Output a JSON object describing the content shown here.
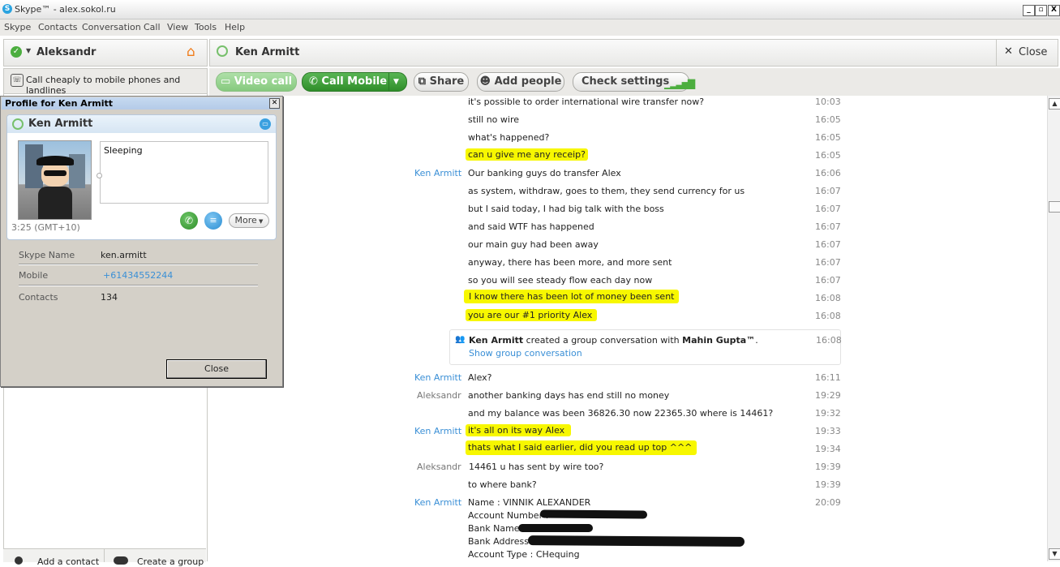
{
  "window": {
    "title": "Skype™ - alex.sokol.ru",
    "logo_letter": "S",
    "min": "_",
    "restore": "▫",
    "close": "X"
  },
  "menu": [
    "Skype",
    "Contacts",
    "Conversation",
    "Call",
    "View",
    "Tools",
    "Help"
  ],
  "left": {
    "user_name": "Aleksandr",
    "ad_text": "Call cheaply to mobile phones and landlines",
    "bottom_add": "Add a contact",
    "bottom_create": "Create a group"
  },
  "conversation": {
    "contact_name": "Ken Armitt",
    "close_label": "Close",
    "buttons": {
      "video_call": "Video call",
      "call_mobile": "Call Mobile",
      "share": "Share",
      "add_people": "Add people",
      "check_settings": "Check settings"
    }
  },
  "messages": [
    {
      "author": "",
      "text": "it's possible to order international wire transfer now?",
      "time": "10:03",
      "highlight": false
    },
    {
      "author": "",
      "text": "still no wire",
      "time": "16:05",
      "highlight": false
    },
    {
      "author": "",
      "text": "what's happened?",
      "time": "16:05",
      "highlight": false
    },
    {
      "author": "",
      "text": "can u give me any receip?",
      "time": "16:05",
      "highlight": true
    },
    {
      "author": "Ken Armitt",
      "text": "Our banking guys do transfer Alex",
      "time": "16:06",
      "highlight": false
    },
    {
      "author": "",
      "text": "as system, withdraw, goes to them, they send currency for us",
      "time": "16:07",
      "highlight": false
    },
    {
      "author": "",
      "text": "but I said today, I had big talk with the boss",
      "time": "16:07",
      "highlight": false
    },
    {
      "author": "",
      "text": "and said WTF has happened",
      "time": "16:07",
      "highlight": false
    },
    {
      "author": "",
      "text": "our main guy had been away",
      "time": "16:07",
      "highlight": false
    },
    {
      "author": "",
      "text": "anyway, there has been more, and more sent",
      "time": "16:07",
      "highlight": false
    },
    {
      "author": "",
      "text": "so you will see steady flow each day now",
      "time": "16:07",
      "highlight": false
    },
    {
      "author": "",
      "text": "I know there has been lot of money been sent",
      "time": "16:08",
      "highlight": true
    },
    {
      "author": "",
      "text": "you are our #1 priority Alex",
      "time": "16:08",
      "highlight": true
    }
  ],
  "group_notice": {
    "actor": "Ken Armitt",
    "middle": " created a group conversation with ",
    "target": "Mahin Gupta™",
    "end": ".",
    "link": "Show group conversation",
    "time": "16:08"
  },
  "messages2": [
    {
      "author": "Ken Armitt",
      "author_type": "ken",
      "text": "Alex?",
      "time": "16:11",
      "highlight": false
    },
    {
      "author": "Aleksandr",
      "author_type": "alek",
      "text": "another banking days has end still no money",
      "time": "19:29",
      "highlight": false
    },
    {
      "author": "",
      "author_type": "",
      "text": "and my balance was been 36826.30 now 22365.30 where is 14461?",
      "time": "19:32",
      "highlight": false
    },
    {
      "author": "Ken Armitt",
      "author_type": "ken",
      "text": "it's all on its way Alex",
      "time": "19:33",
      "highlight": true
    },
    {
      "author": "",
      "author_type": "",
      "text": "thats what I said earlier, did you read up top ^^^",
      "time": "19:34",
      "highlight": true
    },
    {
      "author": "Aleksandr",
      "author_type": "alek",
      "text": "14461 u has sent by wire too?",
      "time": "19:39",
      "highlight": false
    },
    {
      "author": "",
      "author_type": "",
      "text": "to where bank?",
      "time": "19:39",
      "highlight": false
    }
  ],
  "bank_block": {
    "author": "Ken Armitt",
    "time": "20:09",
    "lines": [
      "Name : VINNIK ALEXANDER",
      "Account Number : ",
      "Bank Name : ",
      "Bank Address : ",
      "Account Type : CHequing"
    ]
  },
  "profile": {
    "title": "Profile for Ken Armitt",
    "name": "Ken Armitt",
    "mood": "Sleeping",
    "local_time": "3:25 (GMT+10)",
    "more_label": "More",
    "skype_name_label": "Skype Name",
    "skype_name": "ken.armitt",
    "mobile_label": "Mobile",
    "mobile": "+61434552244",
    "contacts_label": "Contacts",
    "contacts": "134",
    "close_label": "Close"
  },
  "colors": {
    "highlight": "#f7f700",
    "link": "#3a8fd6",
    "green": "#3a9e34"
  }
}
